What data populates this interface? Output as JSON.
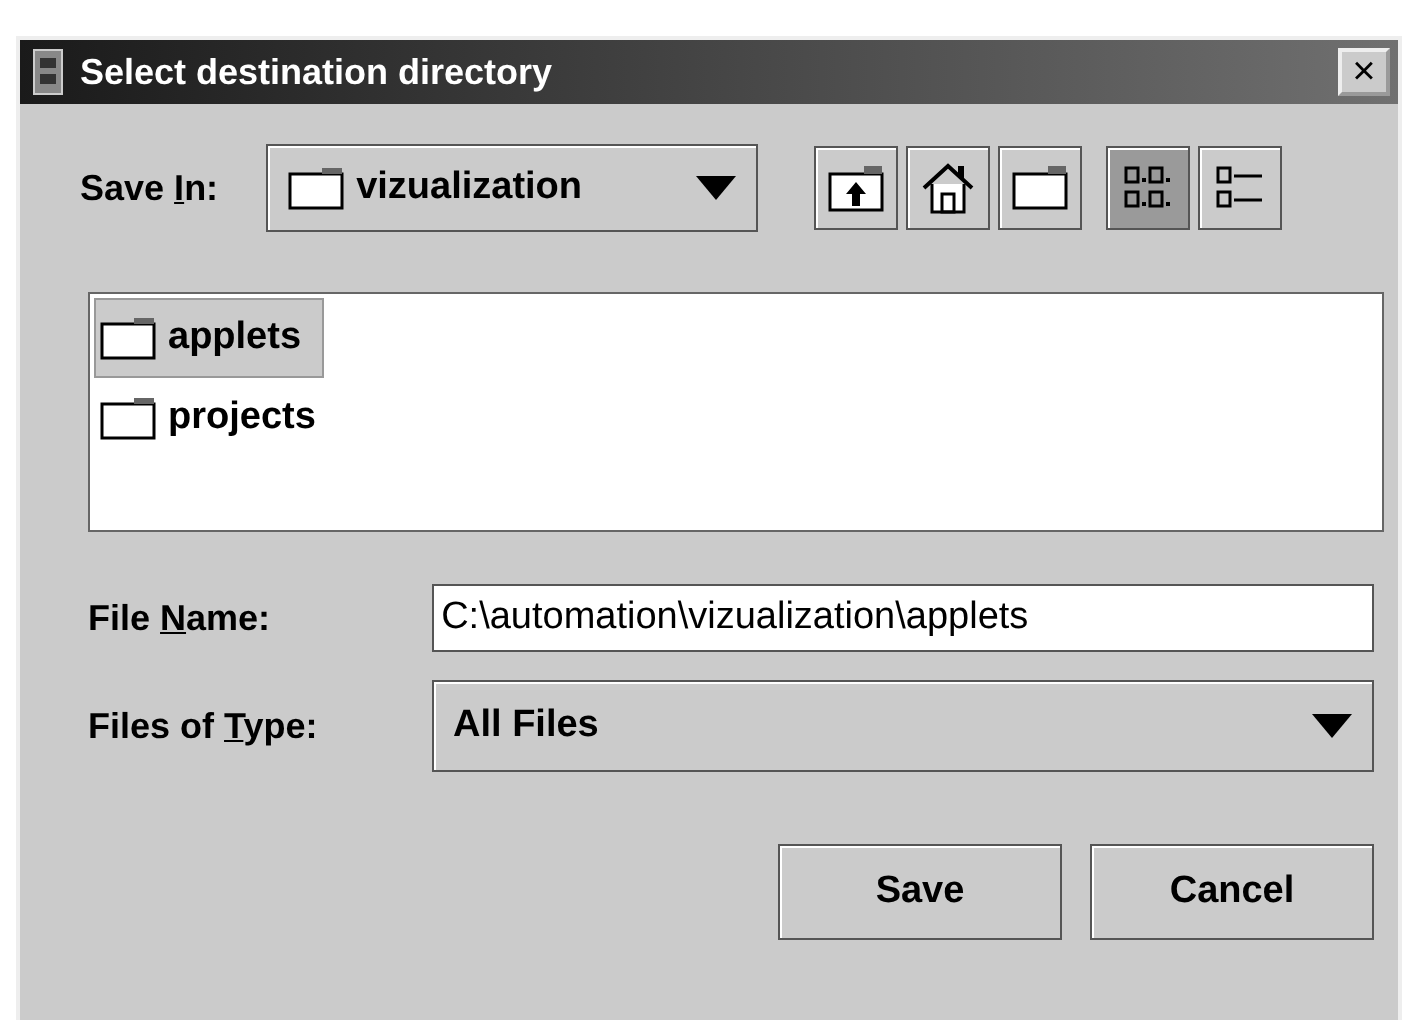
{
  "window": {
    "title": "Select destination directory",
    "close": "×"
  },
  "save_in": {
    "label": {
      "before": "Save ",
      "key": "I",
      "after": "n:"
    },
    "value": "vizualization"
  },
  "toolbar": [
    {
      "kind": "up",
      "selected": false
    },
    {
      "kind": "home",
      "selected": false
    },
    {
      "kind": "newfolder",
      "selected": false
    },
    {
      "kind": "list",
      "selected": true
    },
    {
      "kind": "details",
      "selected": false
    }
  ],
  "files": [
    {
      "name": "applets",
      "selected": true
    },
    {
      "name": "projects",
      "selected": false
    }
  ],
  "file_name": {
    "label": {
      "before": "File ",
      "key": "N",
      "after": "ame:"
    },
    "value": "C:\\automation\\vizualization\\applets"
  },
  "file_type": {
    "label": {
      "before": "Files of ",
      "key": "T",
      "after": "ype:"
    },
    "value": "All Files"
  },
  "buttons": [
    "Save",
    "Cancel"
  ]
}
